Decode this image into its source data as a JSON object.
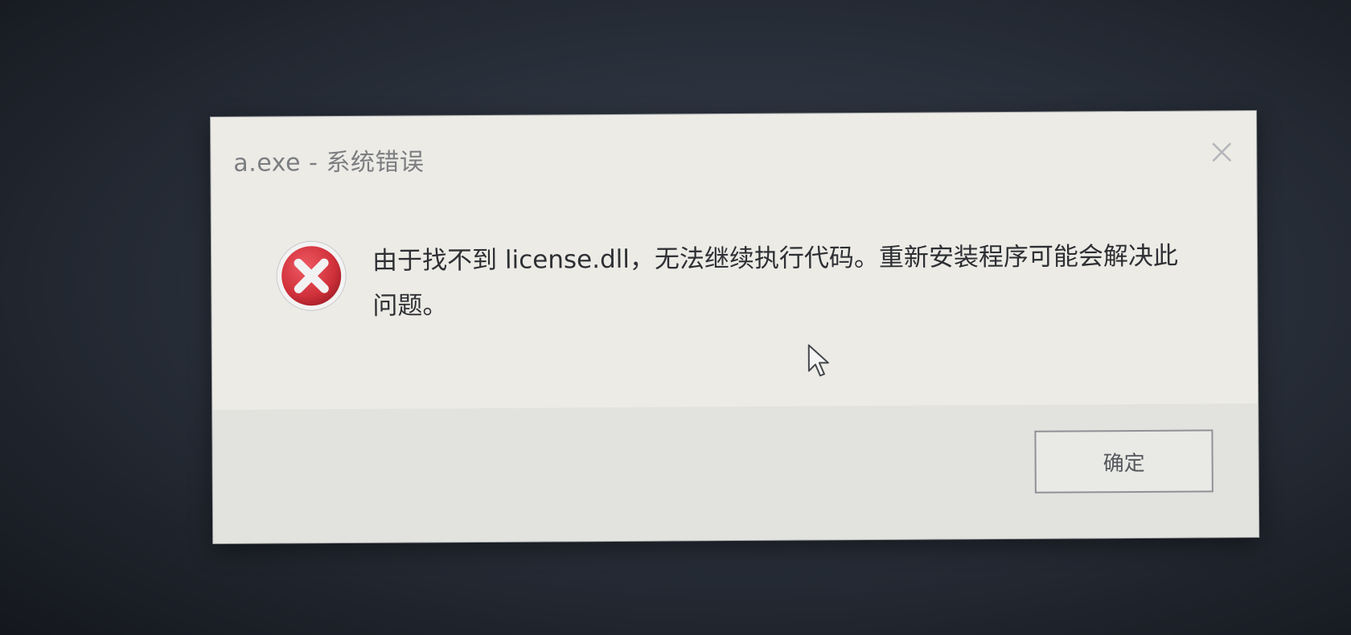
{
  "dialog": {
    "title": "a.exe - 系统错误",
    "message": "由于找不到 license.dll，无法继续执行代码。重新安装程序可能会解决此问题。",
    "ok_label": "确定",
    "close_icon": "close-icon",
    "status_icon": "error-icon",
    "colors": {
      "error_red": "#d0313b",
      "dialog_bg": "#ecebe6",
      "footer_bg": "#e2e2de"
    }
  }
}
